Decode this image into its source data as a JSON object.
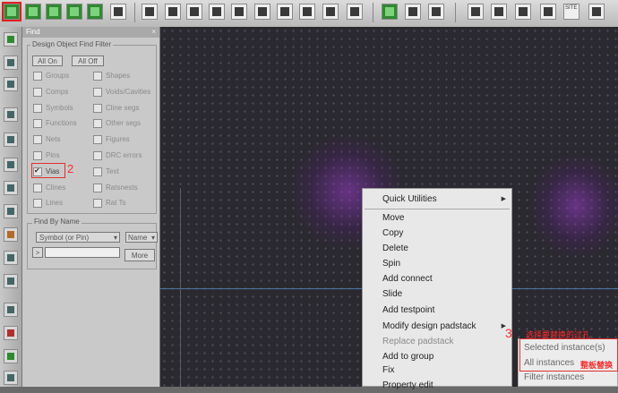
{
  "find_panel": {
    "title": "Find",
    "close": "×",
    "filter": {
      "legend": "Design Object Find Filter",
      "all_on": "All On",
      "all_off": "All Off",
      "left": [
        {
          "label": "Groups",
          "checked": false
        },
        {
          "label": "Comps",
          "checked": false
        },
        {
          "label": "Symbols",
          "checked": false
        },
        {
          "label": "Functions",
          "checked": false
        },
        {
          "label": "Nets",
          "checked": false
        },
        {
          "label": "Pins",
          "checked": false
        },
        {
          "label": "Vias",
          "checked": true
        },
        {
          "label": "Clines",
          "checked": false
        },
        {
          "label": "Lines",
          "checked": false
        }
      ],
      "right": [
        {
          "label": "Shapes",
          "checked": false
        },
        {
          "label": "Voids/Cavities",
          "checked": false
        },
        {
          "label": "Cline segs",
          "checked": false
        },
        {
          "label": "Other segs",
          "checked": false
        },
        {
          "label": "Figures",
          "checked": false
        },
        {
          "label": "DRC errors",
          "checked": false
        },
        {
          "label": "Text",
          "checked": false
        },
        {
          "label": "Ratsnests",
          "checked": false
        },
        {
          "label": "Rat Ts",
          "checked": false
        }
      ]
    },
    "find_by_name": {
      "legend": "Find By Name",
      "type_value": "Symbol (or Pin)",
      "name_value": "Name",
      "arrow_btn": ">",
      "more": "More"
    }
  },
  "annotations": {
    "step2": "2",
    "step3": "3",
    "step3_note": "选择要替换的过孔",
    "replace_note": "整板替换"
  },
  "context_menu": {
    "items": [
      {
        "label": "Quick Utilities",
        "submenu": true
      },
      {
        "label": "Move"
      },
      {
        "label": "Copy"
      },
      {
        "label": "Delete"
      },
      {
        "label": "Spin"
      },
      {
        "label": "Add connect"
      },
      {
        "label": "Slide"
      },
      {
        "label": "Add testpoint"
      },
      {
        "label": "Modify design padstack",
        "submenu": true
      },
      {
        "label": "Replace padstack"
      },
      {
        "label": "Add to group"
      },
      {
        "label": "Fix"
      },
      {
        "label": "Property edit"
      }
    ]
  },
  "sub_menu": {
    "items": [
      {
        "label": "Selected instance(s)"
      },
      {
        "label": "All instances"
      },
      {
        "label": "Filter instances"
      }
    ]
  },
  "toolbar_extra": {
    "label": "SITE"
  },
  "colors": {
    "annotation": "#ff2b2b",
    "canvas": "#2b2930",
    "via_glow": "#9a3cc8"
  }
}
